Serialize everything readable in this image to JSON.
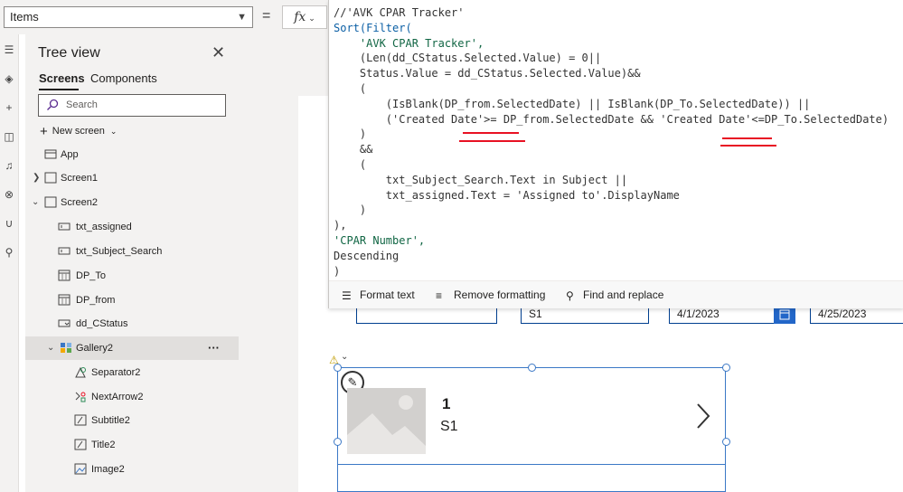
{
  "formula_bar": {
    "property": "Items",
    "equals": "=",
    "fx_label": "fx"
  },
  "tree": {
    "title": "Tree view",
    "tabs": [
      "Screens",
      "Components"
    ],
    "search_placeholder": "Search",
    "new_screen": "New screen",
    "nodes": [
      "App",
      "Screen1",
      "Screen2",
      "txt_assigned",
      "txt_Subject_Search",
      "DP_To",
      "DP_from",
      "dd_CStatus",
      "Gallery2",
      "Separator2",
      "NextArrow2",
      "Subtitle2",
      "Title2",
      "Image2"
    ],
    "more": "···"
  },
  "editor": {
    "lines": [
      "//'AVK CPAR Tracker'",
      "Sort(Filter(",
      "    'AVK CPAR Tracker',",
      "    (Len(dd_CStatus.Selected.Value) = 0||",
      "    Status.Value = dd_CStatus.Selected.Value)&&",
      "    (",
      "        (IsBlank(DP_from.SelectedDate) || IsBlank(DP_To.SelectedDate)) ||",
      "        ('Created Date'>= DP_from.SelectedDate && 'Created Date'<=DP_To.SelectedDate)",
      "    )",
      "    &&",
      "    (",
      "        txt_Subject_Search.Text in Subject ||",
      "        txt_assigned.Text = 'Assigned to'.DisplayName",
      "    )",
      "),",
      "'CPAR Number',",
      "Descending",
      ")"
    ],
    "toolbar": {
      "format_text": "Format text",
      "remove_formatting": "Remove formatting",
      "find_replace": "Find and replace"
    }
  },
  "controls": {
    "subject_value": "S1",
    "from_date": "4/1/2023",
    "to_date": "4/25/2023"
  },
  "gallery": {
    "title": "1",
    "subtitle": "S1"
  },
  "colors": {
    "accent": "#3b78c6",
    "error_underline": "#e81123",
    "panel_bg": "#f3f2f1"
  }
}
